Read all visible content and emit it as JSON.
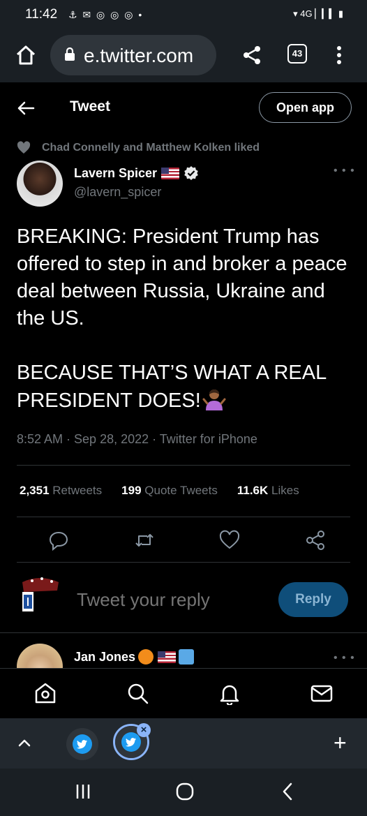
{
  "status_bar": {
    "time": "11:42",
    "left_icons": "⚓ ✉ ◎ ◎ ◎ •",
    "right_icons": "▾ 4G ▏▎▍ ▮"
  },
  "browser": {
    "url": "e.twitter.com",
    "tab_count": "43"
  },
  "header": {
    "title": "Tweet",
    "open_app_label": "Open app"
  },
  "social_context": "Chad Connelly and Matthew Kolken liked",
  "author": {
    "name": "Lavern Spicer",
    "handle": "@lavern_spicer"
  },
  "tweet": {
    "text": "BREAKING: President Trump has offered to step in and broker a peace deal between Russia, Ukraine and the US.\n\nBECAUSE THAT’S WHAT A REAL PRESIDENT DOES!",
    "timestamp": "8:52 AM · Sep 28, 2022 · Twitter for iPhone"
  },
  "stats": {
    "retweets_count": "2,351",
    "retweets_label": "Retweets",
    "quotes_count": "199",
    "quotes_label": "Quote Tweets",
    "likes_count": "11.6K",
    "likes_label": "Likes"
  },
  "reply": {
    "placeholder": "Tweet your reply",
    "button_label": "Reply"
  },
  "next_tweet": {
    "author_name": "Jan Jones"
  },
  "colors": {
    "background": "#000000",
    "accent": "#1d9bf0",
    "secondary_text": "#71767b",
    "divider": "#2f3336",
    "reply_button": "#0f4e7a"
  },
  "icons": {
    "home": "home-icon",
    "lock": "lock-icon",
    "share": "share-icon",
    "menu": "kebab-menu-icon",
    "back": "back-arrow-icon",
    "heart": "heart-icon",
    "verified": "verified-badge-icon",
    "reply": "reply-icon",
    "retweet": "retweet-icon",
    "like": "like-icon",
    "share_tweet": "share-tweet-icon",
    "nav_home": "twitter-home-icon",
    "nav_search": "search-icon",
    "nav_notifications": "bell-icon",
    "nav_messages": "envelope-icon"
  }
}
